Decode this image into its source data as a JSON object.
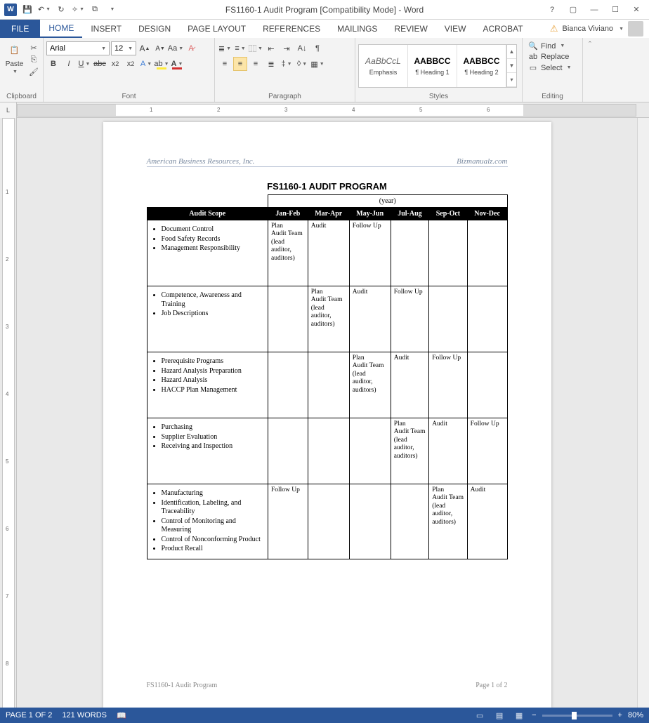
{
  "titlebar": {
    "title": "FS1160-1 Audit Program [Compatibility Mode] - Word"
  },
  "user": {
    "name": "Bianca Viviano"
  },
  "tabs": {
    "file": "FILE",
    "home": "HOME",
    "insert": "INSERT",
    "design": "DESIGN",
    "pagelayout": "PAGE LAYOUT",
    "references": "REFERENCES",
    "mailings": "MAILINGS",
    "review": "REVIEW",
    "view": "VIEW",
    "acrobat": "ACROBAT"
  },
  "ribbon": {
    "clipboard": {
      "paste": "Paste",
      "label": "Clipboard"
    },
    "font": {
      "name": "Arial",
      "size": "12",
      "label": "Font"
    },
    "paragraph": {
      "label": "Paragraph"
    },
    "styles": {
      "label": "Styles",
      "items": [
        {
          "preview": "AaBbCcL",
          "name": "Emphasis",
          "italic": true
        },
        {
          "preview": "AABBCC",
          "name": "¶ Heading 1",
          "bold": true
        },
        {
          "preview": "AABBCC",
          "name": "¶ Heading 2",
          "bold": true
        }
      ]
    },
    "editing": {
      "find": "Find",
      "replace": "Replace",
      "select": "Select",
      "label": "Editing"
    }
  },
  "document": {
    "header_left": "American Business Resources, Inc.",
    "header_right": "Bizmanualz.com",
    "title": "FS1160-1   AUDIT PROGRAM",
    "year_label": "(year)",
    "columns": [
      "Audit Scope",
      "Jan-Feb",
      "Mar-Apr",
      "May-Jun",
      "Jul-Aug",
      "Sep-Oct",
      "Nov-Dec"
    ],
    "cell_plan_team": "Plan\nAudit Team (lead auditor, auditors)",
    "cell_audit": "Audit",
    "cell_followup": "Follow Up",
    "rows": [
      {
        "scope": [
          "Document Control",
          "Food Safety Records",
          "Management Responsibility"
        ],
        "cells": [
          "plan",
          "audit",
          "follow",
          "",
          "",
          ""
        ]
      },
      {
        "scope": [
          "Competence, Awareness and Training",
          "Job Descriptions"
        ],
        "cells": [
          "",
          "plan",
          "audit",
          "follow",
          "",
          ""
        ]
      },
      {
        "scope": [
          "Prerequisite Programs",
          "Hazard Analysis Preparation",
          "Hazard Analysis",
          "HACCP Plan Management"
        ],
        "cells": [
          "",
          "",
          "plan",
          "audit",
          "follow",
          ""
        ]
      },
      {
        "scope": [
          "Purchasing",
          "Supplier Evaluation",
          "Receiving and Inspection"
        ],
        "cells": [
          "",
          "",
          "",
          "plan",
          "audit",
          "follow"
        ]
      },
      {
        "scope": [
          "Manufacturing",
          "Identification, Labeling, and Traceability",
          "Control of Monitoring and Measuring",
          "Control of Nonconforming Product",
          "Product Recall"
        ],
        "cells": [
          "follow",
          "",
          "",
          "",
          "plan",
          "audit"
        ]
      }
    ],
    "footer_left": "FS1160-1 Audit Program",
    "footer_right": "Page 1 of 2"
  },
  "status": {
    "page": "PAGE 1 OF 2",
    "words": "121 WORDS",
    "zoom": "80%"
  }
}
